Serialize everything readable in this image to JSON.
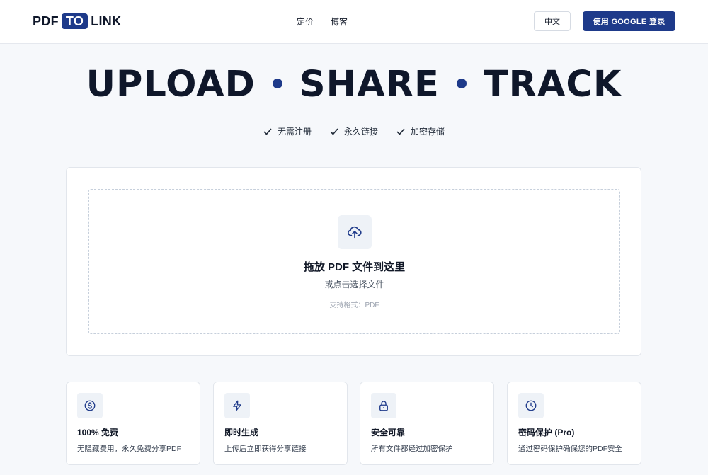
{
  "header": {
    "logo_left": "PDF",
    "logo_mid": "TO",
    "logo_right": "LINK",
    "nav": [
      "定价",
      "博客"
    ],
    "lang_label": "中文",
    "login_label": "使用 GOOGLE 登录"
  },
  "hero": {
    "words": [
      "UPLOAD",
      "SHARE",
      "TRACK"
    ],
    "highlights": [
      "无需注册",
      "永久链接",
      "加密存储"
    ]
  },
  "upload": {
    "title": "拖放 PDF 文件到这里",
    "subtitle": "或点击选择文件",
    "formats": "支持格式：PDF"
  },
  "features": [
    {
      "icon": "dollar-icon",
      "title": "100% 免费",
      "desc": "无隐藏费用，永久免费分享PDF"
    },
    {
      "icon": "lightning-icon",
      "title": "即时生成",
      "desc": "上传后立即获得分享链接"
    },
    {
      "icon": "lock-icon",
      "title": "安全可靠",
      "desc": "所有文件都经过加密保护"
    },
    {
      "icon": "clock-icon",
      "title": "密码保护 (Pro)",
      "desc": "通过密码保护确保您的PDF安全"
    }
  ],
  "colors": {
    "accent": "#1e3a8a",
    "background": "#f6f8fb",
    "text": "#0f172a"
  }
}
